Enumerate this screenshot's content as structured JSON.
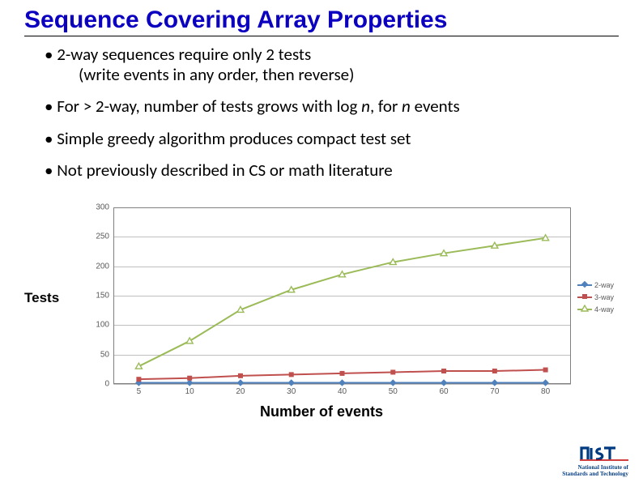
{
  "title": "Sequence Covering Array Properties",
  "bullets": [
    {
      "text": "2-way sequences require only 2 tests",
      "sub": "(write events in any order, then  reverse)"
    },
    {
      "text_pre": "For > 2-way, number of tests grows with log ",
      "i1": "n",
      "mid": ", for ",
      "i2": "n",
      "text_post": " events"
    },
    {
      "text": "Simple greedy algorithm produces compact test set"
    },
    {
      "text": "Not previously described in CS or math literature"
    }
  ],
  "y_axis_title": "Tests",
  "x_axis_title": "Number of events",
  "brand": {
    "line1": "National Institute of",
    "line2": "Standards and Technology"
  },
  "chart_data": {
    "type": "line",
    "xlabel": "Number of events",
    "ylabel": "Tests",
    "x": [
      5,
      10,
      20,
      30,
      40,
      50,
      60,
      70,
      80
    ],
    "ylim": [
      0,
      300
    ],
    "yticks": [
      0,
      50,
      100,
      150,
      200,
      250,
      300
    ],
    "series": [
      {
        "name": "2-way",
        "color": "#4f81bd",
        "marker": "diamond",
        "values": [
          2,
          2,
          2,
          2,
          2,
          2,
          2,
          2,
          2
        ]
      },
      {
        "name": "3-way",
        "color": "#c0504d",
        "marker": "square",
        "values": [
          8,
          10,
          14,
          16,
          18,
          20,
          22,
          22,
          24
        ]
      },
      {
        "name": "4-way",
        "color": "#9bbb59",
        "marker": "triangle",
        "values": [
          30,
          73,
          126,
          160,
          186,
          207,
          222,
          235,
          248
        ]
      }
    ],
    "legend": [
      "2-way",
      "3-way",
      "4-way"
    ]
  }
}
